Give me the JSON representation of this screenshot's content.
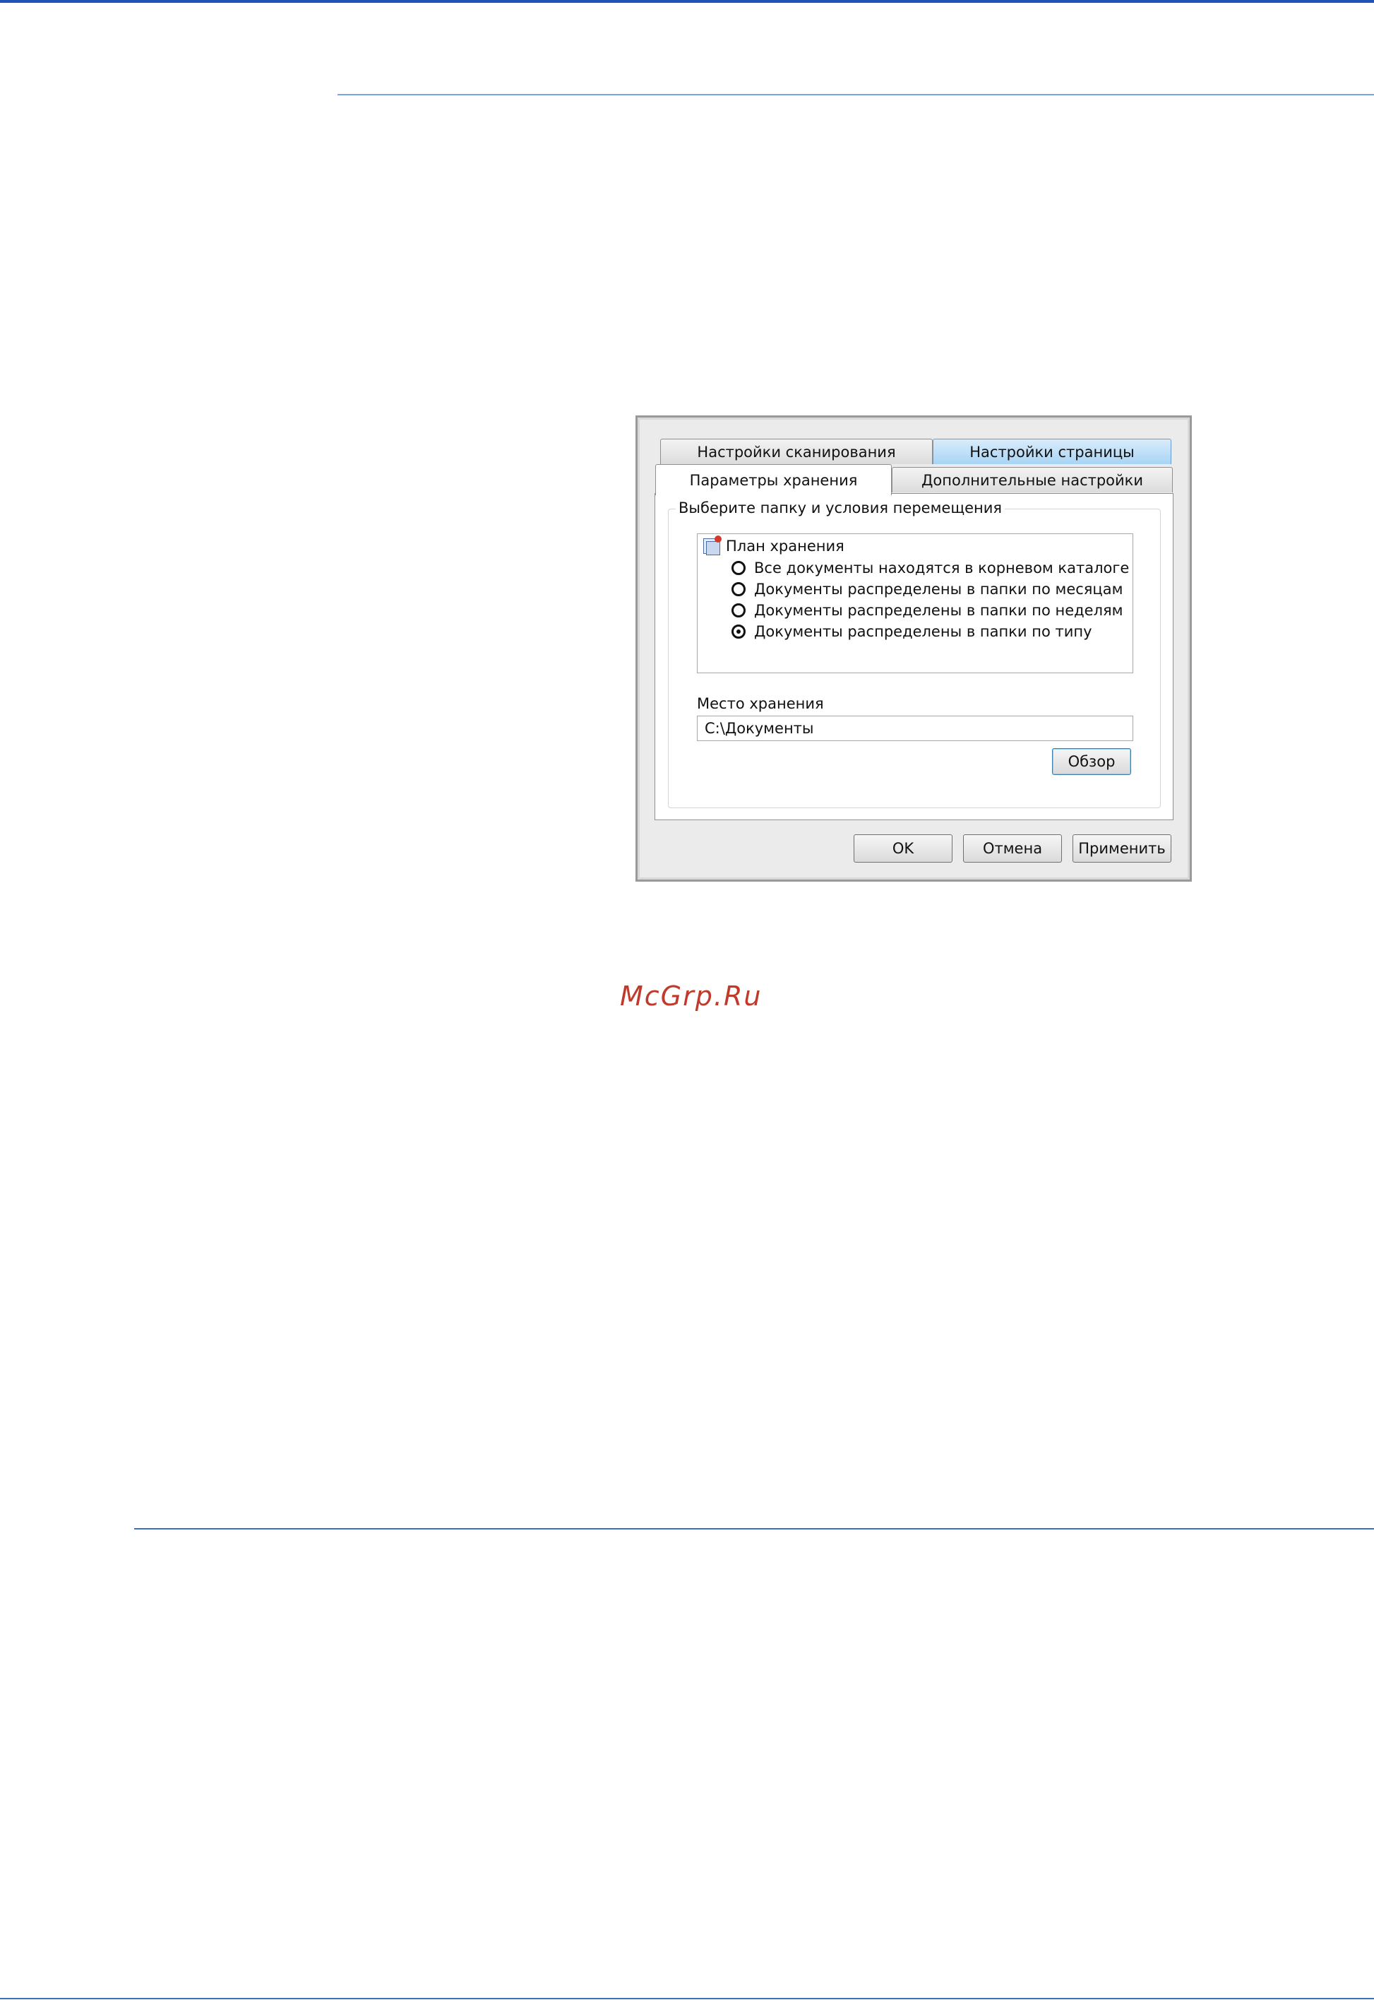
{
  "dialog": {
    "tabs": {
      "scan_settings": "Настройки сканирования",
      "page_settings": "Настройки страницы",
      "storage_options": "Параметры хранения",
      "advanced_settings": "Дополнительные настройки"
    },
    "group_label": "Выберите папку и условия перемещения",
    "tree": {
      "root_label": "План хранения",
      "options": [
        {
          "label": "Все документы находятся в корневом каталоге",
          "selected": false
        },
        {
          "label": "Документы распределены в папки по месяцам",
          "selected": false
        },
        {
          "label": "Документы распределены в папки по неделям",
          "selected": false
        },
        {
          "label": "Документы распределены в папки по типу",
          "selected": true
        }
      ]
    },
    "location": {
      "label": "Место хранения",
      "value": "C:\\Документы"
    },
    "buttons": {
      "browse": "Обзор",
      "ok": "OK",
      "cancel": "Отмена",
      "apply": "Применить"
    }
  },
  "watermark": "McGrp.Ru",
  "colors": {
    "rule_blue": "#3a6fc4",
    "active_tab_blue": "#a8d4f5",
    "watermark_red": "#c0392b"
  }
}
